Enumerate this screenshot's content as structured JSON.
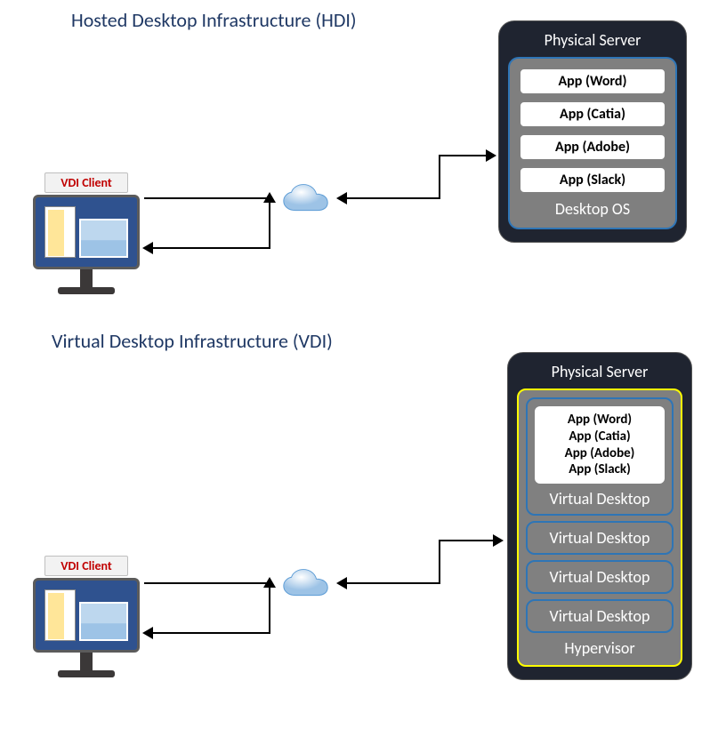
{
  "hdi": {
    "title": "Hosted Desktop Infrastructure (HDI)",
    "client_label": "VDI Client",
    "server_label": "Physical Server",
    "os_label": "Desktop OS",
    "apps": {
      "a0": "App (Word)",
      "a1": "App (Catia)",
      "a2": "App (Adobe)",
      "a3": "App (Slack)"
    }
  },
  "vdi": {
    "title": "Virtual Desktop Infrastructure (VDI)",
    "client_label": "VDI Client",
    "server_label": "Physical Server",
    "hypervisor_label": "Hypervisor",
    "vdesk_label": "Virtual Desktop",
    "apps": {
      "a0": "App (Word)",
      "a1": "App (Catia)",
      "a2": "App (Adobe)",
      "a3": "App (Slack)"
    }
  }
}
